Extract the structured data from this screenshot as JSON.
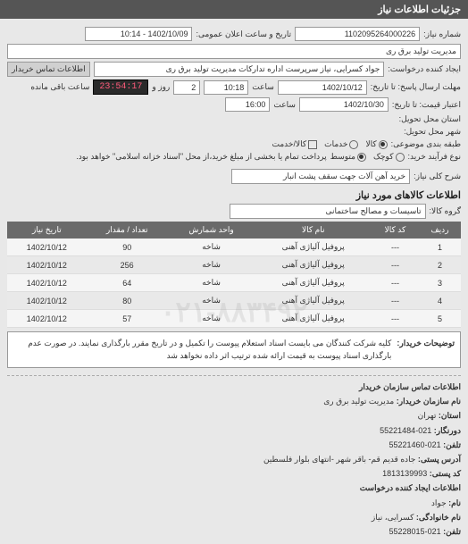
{
  "header": "جزئیات اطلاعات نیاز",
  "fields": {
    "request_no_label": "شماره نیاز:",
    "request_no": "1102095264000226",
    "public_date_label": "تاریخ و ساعت اعلان عمومی:",
    "public_date": "1402/10/09 - 10:14",
    "buyer_unit_label": "مدیریت تولید برق ری",
    "requester_label": "ایجاد کننده درخواست:",
    "requester": "جواد کسرایی، نیاز سرپرست اداره تدارکات مدیریت تولید برق ری",
    "buyer_contact_btn": "اطلاعات تماس خریدار",
    "deadline_label": "مهلت ارسال پاسخ: تا تاریخ:",
    "deadline_date": "1402/10/12",
    "time_label": "ساعت",
    "deadline_time": "10:18",
    "days_remaining": "2",
    "days_remaining_label": "روز و",
    "timer": "23:54:17",
    "timer_label": "ساعت باقی مانده",
    "validity_label": "اعتبار قیمت: تا تاریخ:",
    "validity_date": "1402/10/30",
    "validity_time": "16:00",
    "delivery_province_label": "استان محل تحویل:",
    "delivery_city_label": "شهر محل تحویل:",
    "category_label": "طبقه بندی موضوعی:",
    "process_label": "نوع فرآیند خرید:",
    "process_note": "پرداخت تمام یا بخشی از مبلغ خرید،از محل \"اسناد خزانه اسلامی\" خواهد بود.",
    "goods_radio": "کالا",
    "services_radio": "خدمات",
    "both_radio": "کالا/خدمت",
    "small_radio": "کوچک",
    "medium_radio": "متوسط",
    "desc_label": "شرح کلی نیاز:",
    "desc": "خرید آهن آلات جهت سقف پشت انبار"
  },
  "items_title": "اطلاعات کالاهای مورد نیاز",
  "group_label": "گروه کالا:",
  "group_value": "تاسیسات و مصالح ساختمانی",
  "table": {
    "headers": [
      "ردیف",
      "کد کالا",
      "نام کالا",
      "واحد شمارش",
      "تعداد / مقدار",
      "تاریخ نیاز"
    ],
    "rows": [
      [
        "1",
        "---",
        "پروفیل آلیاژی آهنی",
        "شاخه",
        "90",
        "1402/10/12"
      ],
      [
        "2",
        "---",
        "پروفیل آلیاژی آهنی",
        "شاخه",
        "256",
        "1402/10/12"
      ],
      [
        "3",
        "---",
        "پروفیل آلیاژی آهنی",
        "شاخه",
        "64",
        "1402/10/12"
      ],
      [
        "4",
        "---",
        "پروفیل آلیاژی آهنی",
        "شاخه",
        "80",
        "1402/10/12"
      ],
      [
        "5",
        "---",
        "پروفیل آلیاژی آهنی",
        "شاخه",
        "57",
        "1402/10/12"
      ]
    ]
  },
  "note": {
    "label": "توضیحات خریدار:",
    "text": "کلیه شرکت کنندگان می بایست اسناد استعلام پیوست را تکمیل و در تاریخ مقرر بارگذاری نمایند. در صورت عدم بارگذاری اسناد پیوست به قیمت ارائه شده ترتیب اثر داده نخواهد شد"
  },
  "footer": {
    "title": "اطلاعات تماس سازمان خریدار",
    "org_label": "نام سازمان خریدار:",
    "org": "مدیریت تولید برق ری",
    "province_label": "استان:",
    "province": "تهران",
    "fax_label": "دورنگار:",
    "fax": "021-55221484",
    "phone_label": "تلفن:",
    "phone": "021-55221460",
    "address_label": "آدرس پستی:",
    "address": "جاده قدیم قم- باقر شهر -انتهای بلوار فلسطین",
    "zip_label": "کد پستی:",
    "zip": "1813139993",
    "creator_title": "اطلاعات ایجاد کننده درخواست",
    "name_label": "نام:",
    "name": "جواد",
    "lname_label": "نام خانوادگی:",
    "lname": "کسرایی، نیاز",
    "creator_phone_label": "تلفن:",
    "creator_phone": "021-55228015"
  },
  "watermark": "۰۲۱-۸۸۳۴۹۲"
}
